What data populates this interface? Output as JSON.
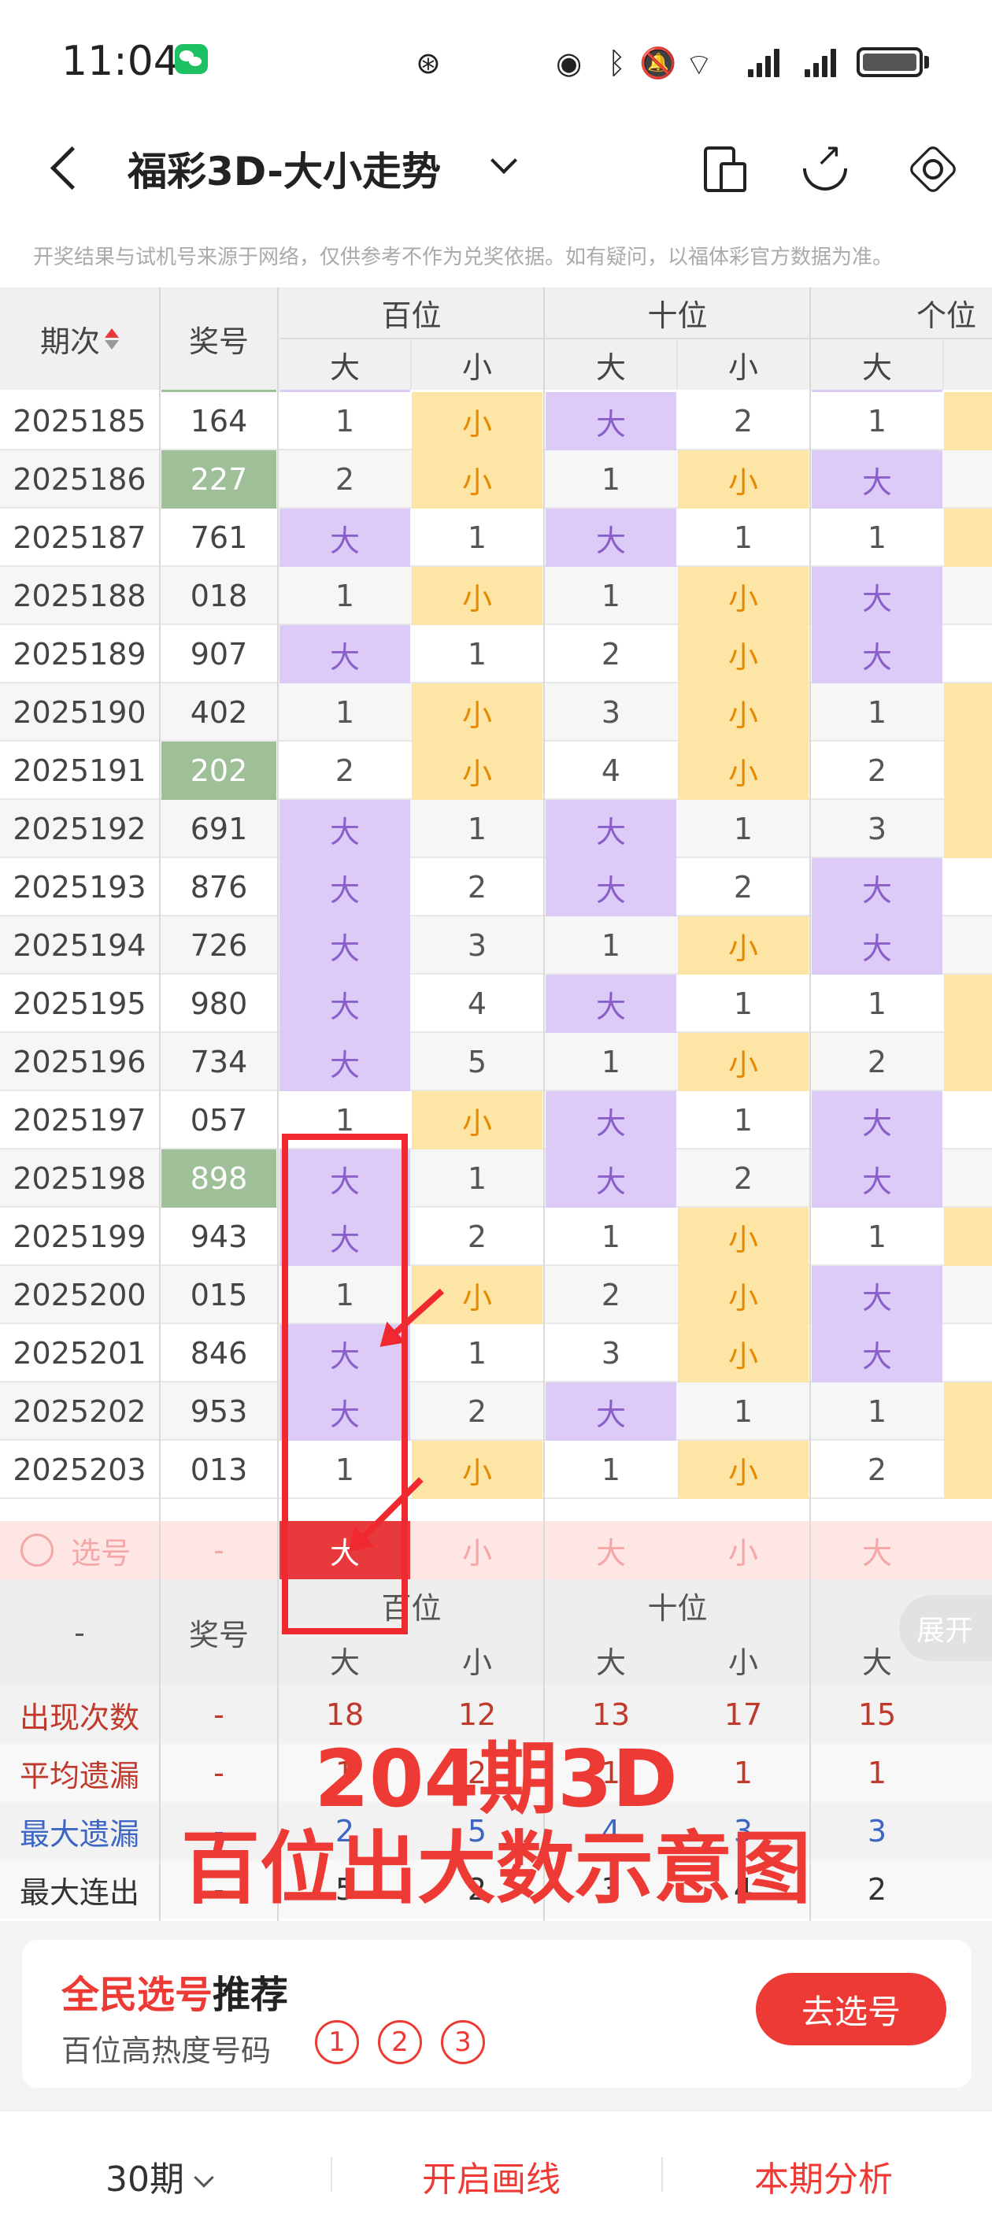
{
  "status": {
    "time": "11:04"
  },
  "header": {
    "title": "福彩3D-大小走势"
  },
  "disclaimer": "开奖结果与试机号来源于网络，仅供参考不作为兑奖依据。如有疑问，以福体彩官方数据为准。",
  "table": {
    "col_period": "期次",
    "col_number": "奖号",
    "groups": [
      "百位",
      "十位",
      "个位"
    ],
    "sub": {
      "big": "大",
      "small": "小"
    },
    "rows": [
      {
        "period": "2025185",
        "number": "164",
        "hot": false,
        "h": [
          "1",
          "小"
        ],
        "t": [
          "大",
          "2"
        ],
        "u": "1"
      },
      {
        "period": "2025186",
        "number": "227",
        "hot": true,
        "h": [
          "2",
          "小"
        ],
        "t": [
          "1",
          "小"
        ],
        "u": "大"
      },
      {
        "period": "2025187",
        "number": "761",
        "hot": false,
        "h": [
          "大",
          "1"
        ],
        "t": [
          "大",
          "1"
        ],
        "u": "1"
      },
      {
        "period": "2025188",
        "number": "018",
        "hot": false,
        "h": [
          "1",
          "小"
        ],
        "t": [
          "1",
          "小"
        ],
        "u": "大"
      },
      {
        "period": "2025189",
        "number": "907",
        "hot": false,
        "h": [
          "大",
          "1"
        ],
        "t": [
          "2",
          "小"
        ],
        "u": "大"
      },
      {
        "period": "2025190",
        "number": "402",
        "hot": false,
        "h": [
          "1",
          "小"
        ],
        "t": [
          "3",
          "小"
        ],
        "u": "1"
      },
      {
        "period": "2025191",
        "number": "202",
        "hot": true,
        "h": [
          "2",
          "小"
        ],
        "t": [
          "4",
          "小"
        ],
        "u": "2"
      },
      {
        "period": "2025192",
        "number": "691",
        "hot": false,
        "h": [
          "大",
          "1"
        ],
        "t": [
          "大",
          "1"
        ],
        "u": "3"
      },
      {
        "period": "2025193",
        "number": "876",
        "hot": false,
        "h": [
          "大",
          "2"
        ],
        "t": [
          "大",
          "2"
        ],
        "u": "大"
      },
      {
        "period": "2025194",
        "number": "726",
        "hot": false,
        "h": [
          "大",
          "3"
        ],
        "t": [
          "1",
          "小"
        ],
        "u": "大"
      },
      {
        "period": "2025195",
        "number": "980",
        "hot": false,
        "h": [
          "大",
          "4"
        ],
        "t": [
          "大",
          "1"
        ],
        "u": "1"
      },
      {
        "period": "2025196",
        "number": "734",
        "hot": false,
        "h": [
          "大",
          "5"
        ],
        "t": [
          "1",
          "小"
        ],
        "u": "2"
      },
      {
        "period": "2025197",
        "number": "057",
        "hot": false,
        "h": [
          "1",
          "小"
        ],
        "t": [
          "大",
          "1"
        ],
        "u": "大"
      },
      {
        "period": "2025198",
        "number": "898",
        "hot": true,
        "h": [
          "大",
          "1"
        ],
        "t": [
          "大",
          "2"
        ],
        "u": "大"
      },
      {
        "period": "2025199",
        "number": "943",
        "hot": false,
        "h": [
          "大",
          "2"
        ],
        "t": [
          "1",
          "小"
        ],
        "u": "1"
      },
      {
        "period": "2025200",
        "number": "015",
        "hot": false,
        "h": [
          "1",
          "小"
        ],
        "t": [
          "2",
          "小"
        ],
        "u": "大"
      },
      {
        "period": "2025201",
        "number": "846",
        "hot": false,
        "h": [
          "大",
          "1"
        ],
        "t": [
          "3",
          "小"
        ],
        "u": "大"
      },
      {
        "period": "2025202",
        "number": "953",
        "hot": false,
        "h": [
          "大",
          "2"
        ],
        "t": [
          "大",
          "1"
        ],
        "u": "1"
      },
      {
        "period": "2025203",
        "number": "013",
        "hot": false,
        "h": [
          "1",
          "小"
        ],
        "t": [
          "1",
          "小"
        ],
        "u": "2"
      }
    ],
    "pick_row": {
      "label": "选号",
      "number": "-",
      "cells": [
        "大",
        "小",
        "大",
        "小",
        "大"
      ]
    },
    "footer_period": "-",
    "footer_number": "奖号",
    "stats": [
      {
        "label": "出现次数",
        "number": "-",
        "values": [
          "18",
          "12",
          "13",
          "17",
          "15"
        ],
        "color": "#c0392b"
      },
      {
        "label": "平均遗漏",
        "number": "-",
        "values": [
          "1",
          "2",
          "1",
          "1",
          "1"
        ],
        "color": "#c0392b"
      },
      {
        "label": "最大遗漏",
        "number": "-",
        "values": [
          "2",
          "5",
          "4",
          "3",
          "3"
        ],
        "color": "#3d66c4"
      },
      {
        "label": "最大连出",
        "number": "-",
        "values": [
          "5",
          "2",
          "3",
          "4",
          "2"
        ],
        "color": "#333333"
      }
    ],
    "expand_label": "展开"
  },
  "overlay": {
    "line1": "204期3D",
    "line2": "百位出大数示意图"
  },
  "recommend": {
    "title_red": "全民选号",
    "title_rest": "推荐",
    "subtitle": "百位高热度号码",
    "balls": [
      "1",
      "2",
      "3"
    ],
    "button": "去选号"
  },
  "bottom": {
    "periods": "30期",
    "draw": "开启画线",
    "analysis": "本期分析"
  },
  "colors": {
    "accent": "#ee3a34",
    "big_bg": "#dccbf6",
    "small_bg": "#fde5a6",
    "hot_bg": "#9fbf98"
  }
}
